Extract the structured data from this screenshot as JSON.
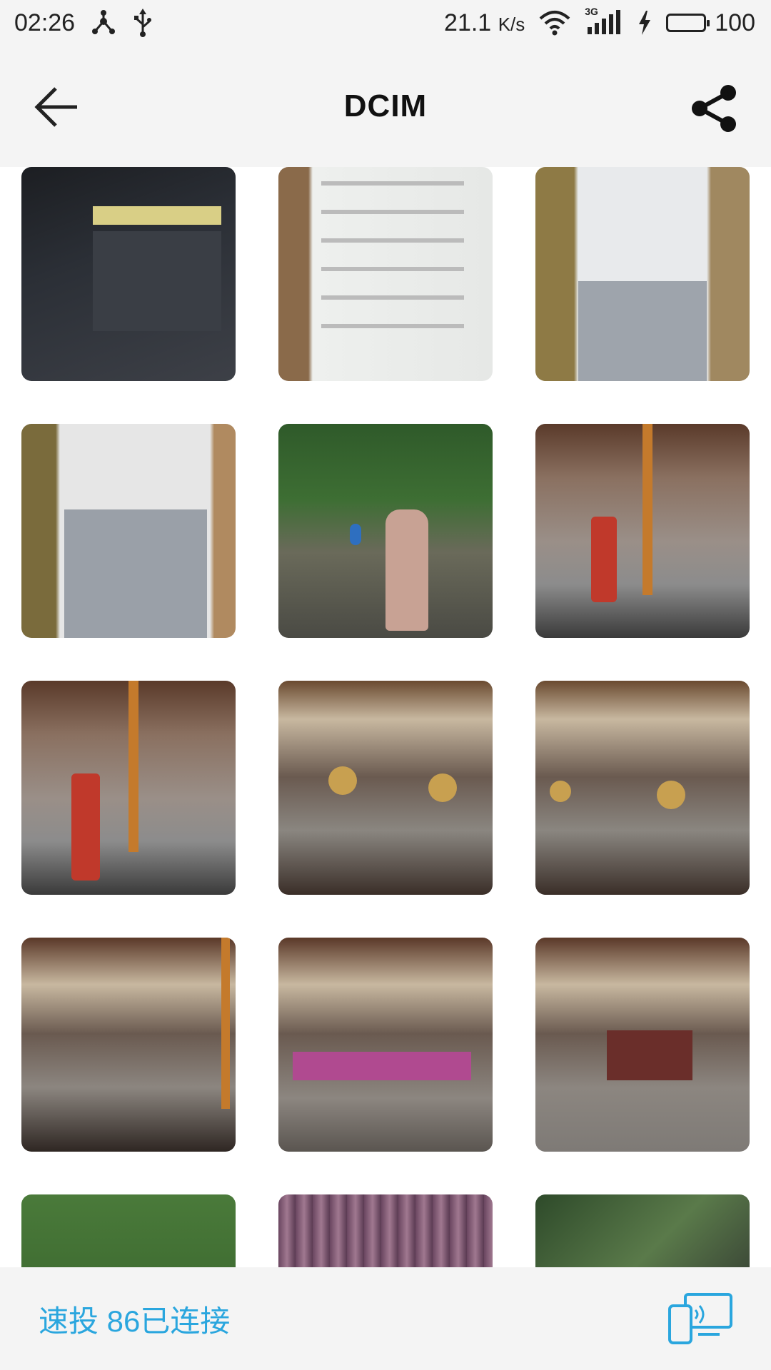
{
  "status_bar": {
    "time": "02:26",
    "speed": "21.1",
    "speed_unit": "K/s",
    "network": "3G",
    "battery": "100",
    "battery_level": 1.0
  },
  "header": {
    "title": "DCIM",
    "back_icon": "back-arrow-icon",
    "share_icon": "share-icon"
  },
  "grid": {
    "thumbnails": [
      {
        "name": "photo-1",
        "desc": "tv-software-update-screen"
      },
      {
        "name": "photo-2",
        "desc": "phone-music-list"
      },
      {
        "name": "photo-3",
        "desc": "phone-menu"
      },
      {
        "name": "photo-4",
        "desc": "phone-music-list-2"
      },
      {
        "name": "photo-5",
        "desc": "parrot-performer"
      },
      {
        "name": "photo-6",
        "desc": "dancer-stage"
      },
      {
        "name": "photo-7",
        "desc": "dancer-stage-2"
      },
      {
        "name": "photo-8",
        "desc": "gong-dance"
      },
      {
        "name": "photo-9",
        "desc": "gong-dance-2"
      },
      {
        "name": "photo-10",
        "desc": "arena-dancers"
      },
      {
        "name": "photo-11",
        "desc": "purple-dancers"
      },
      {
        "name": "photo-12",
        "desc": "arena-group"
      },
      {
        "name": "photo-13",
        "desc": "forest-roof"
      },
      {
        "name": "photo-14",
        "desc": "cave-purple"
      },
      {
        "name": "photo-15",
        "desc": "cave-green"
      }
    ]
  },
  "bottom_bar": {
    "cast_status": "速投 86已连接",
    "cast_icon": "screen-cast-icon"
  },
  "colors": {
    "accent": "#2aa6de",
    "background": "#f4f4f4"
  }
}
